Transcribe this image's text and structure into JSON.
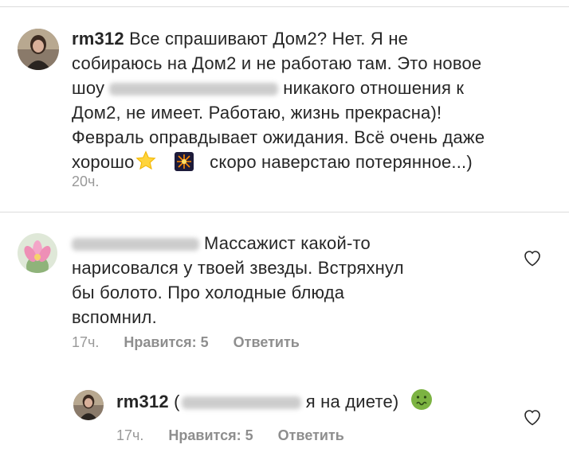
{
  "comments": [
    {
      "username": "rm312",
      "text_line1": "Все спрашивают Дом2? Нет. Я не",
      "text_line2": "собираюсь на Дом2 и не работаю там. Это новое",
      "text_line3_start": "шоу",
      "text_line3_end": "никакого отношения к",
      "text_line4": "Дом2, не имеет. Работаю, жизнь прекрасна)!",
      "text_line5": "Февраль оправдывает ожидания. Всё очень даже",
      "text_line6_start": "хорошо",
      "text_line6_end": "скоро наверстаю потерянное...)",
      "emoji_1": "star-emoji",
      "emoji_2": "fireworks-emoji",
      "time": "20ч."
    },
    {
      "text_line1": "Массажист какой-то",
      "text_line2": "нарисовался  у  твоей  звезды.  Встряхнул",
      "text_line3": "бы  болото.  Про холодные блюда",
      "text_line4": "вспомнил.",
      "time": "17ч.",
      "likes": "Нравится: 5",
      "reply": "Ответить"
    },
    {
      "username": "rm312",
      "text_open": "(",
      "text_end": "я на диете)",
      "emoji": "nauseated-face-emoji",
      "time": "17ч.",
      "likes": "Нравится: 5",
      "reply": "Ответить"
    }
  ],
  "icons": {
    "heart": "heart-outline-icon",
    "avatar_color_1": "#5a4a3a",
    "avatar_color_2": "#c9b8d8",
    "nauseated_color": "#7cb342"
  }
}
